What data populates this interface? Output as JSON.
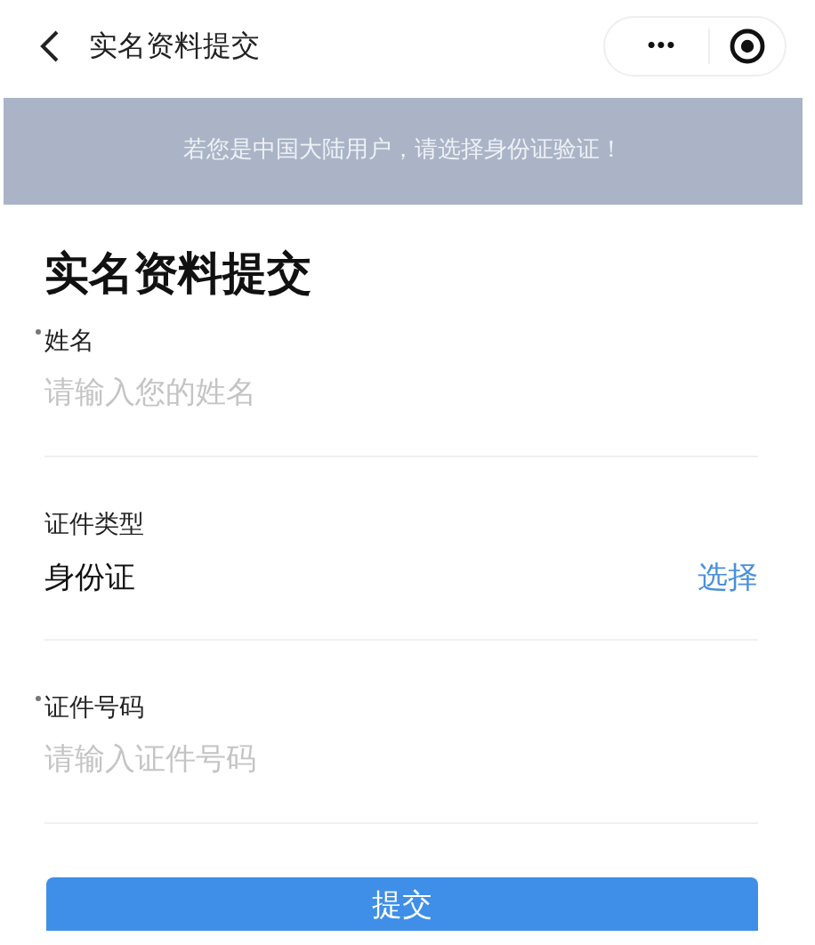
{
  "nav_bar": {
    "title": "实名资料提交",
    "more_button": "•••"
  },
  "notice": "若您是中国大陆用户，请选择身份证验证！",
  "heading": "实名资料提交",
  "fields": [
    {
      "kind": "input",
      "label": "姓名",
      "required": true,
      "placeholder": "请输入您的姓名"
    },
    {
      "kind": "select",
      "label": "证件类型",
      "required": false,
      "value": "身份证",
      "action": "选择"
    },
    {
      "kind": "input",
      "label": "证件号码",
      "required": true,
      "placeholder": "请输入证件号码"
    }
  ],
  "submit_button": "提交"
}
